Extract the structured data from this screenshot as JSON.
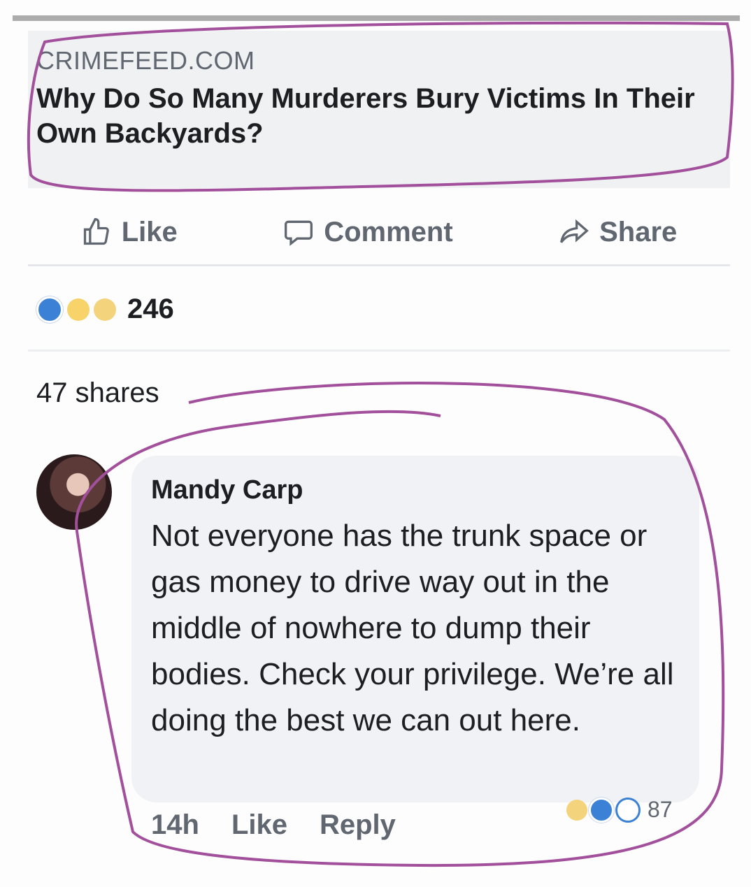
{
  "post": {
    "domain": "CRIMEFEED.COM",
    "headline": "Why Do So Many Murderers Bury Victims In Their Own Backyards?"
  },
  "actions": {
    "like": "Like",
    "comment": "Comment",
    "share": "Share"
  },
  "stats": {
    "reaction_count": "246",
    "shares": "47 shares"
  },
  "comment": {
    "author": "Mandy Carp",
    "text": "Not everyone has the trunk space or gas money to drive way out in the middle of nowhere to dump their bodies. Check your privilege. We’re all doing the best we can out here.",
    "time": "14h",
    "like": "Like",
    "reply": "Reply",
    "reaction_count": "87"
  },
  "colors": {
    "annotation": "#a2509c",
    "like_blue": "#3b82d6",
    "muted_text": "#606770"
  }
}
